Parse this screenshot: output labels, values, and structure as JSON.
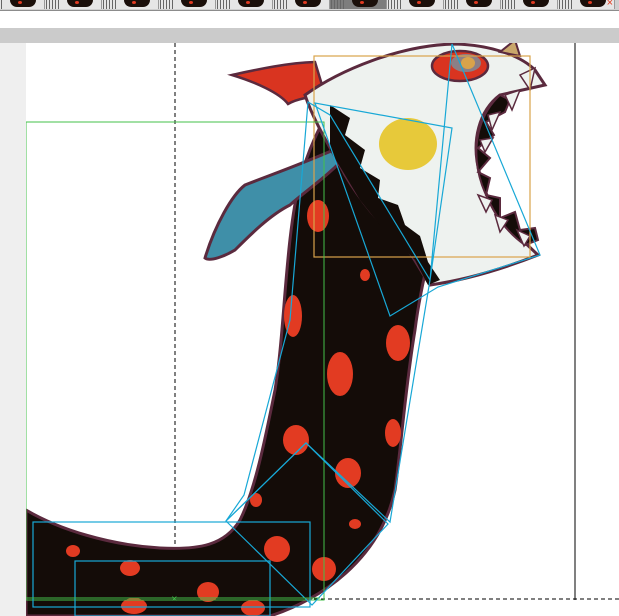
{
  "filmstrip": {
    "frames": [
      {
        "selected": false
      },
      {
        "selected": false
      },
      {
        "selected": false
      },
      {
        "selected": false
      },
      {
        "selected": false
      },
      {
        "selected": false
      },
      {
        "selected": true
      },
      {
        "selected": false
      },
      {
        "selected": false
      },
      {
        "selected": false
      },
      {
        "selected": false
      }
    ],
    "close_icon": "close-icon",
    "close_glyph": "×"
  },
  "colors": {
    "body": "#140c08",
    "spots": "#e23b22",
    "head": "#eef2ef",
    "outline": "#5b2a3e",
    "wing": "#3f8fa8",
    "crest": "#d93420",
    "eye_spot": "#e7c93a",
    "horn": "#c9a66b",
    "bone_box": "#18a8d6",
    "bone_box_green": "#43c04a",
    "head_bbox": "#d9a34a",
    "guide": "#000000"
  },
  "canvas": {
    "icon": "dragon-sprite-image"
  }
}
